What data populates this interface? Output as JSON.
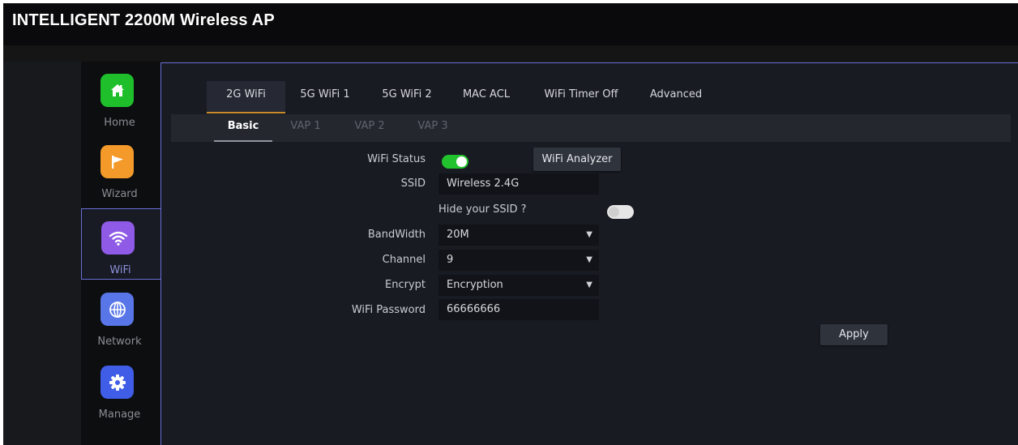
{
  "app": {
    "title": "INTELLIGENT 2200M Wireless AP"
  },
  "sidebar": {
    "items": [
      {
        "label": "Home",
        "icon": "home-icon",
        "color": "#1fbf2c"
      },
      {
        "label": "Wizard",
        "icon": "flag-icon",
        "color": "#f39a2a"
      },
      {
        "label": "WiFi",
        "icon": "wifi-icon",
        "color": "#8e5ae6"
      },
      {
        "label": "Network",
        "icon": "globe-icon",
        "color": "#5876e8"
      },
      {
        "label": "Manage",
        "icon": "gear-icon",
        "color": "#3f5de6"
      }
    ],
    "active": "WiFi"
  },
  "tabs": [
    "2G WiFi",
    "5G WiFi 1",
    "5G WiFi 2",
    "MAC ACL",
    "WiFi Timer Off",
    "Advanced"
  ],
  "active_tab": "2G WiFi",
  "subtabs": [
    "Basic",
    "VAP 1",
    "VAP 2",
    "VAP 3"
  ],
  "active_subtab": "Basic",
  "form": {
    "wifi_status_label": "WiFi Status",
    "wifi_status_on": true,
    "analyzer_button": "WiFi Analyzer",
    "ssid_label": "SSID",
    "ssid_value": "Wireless 2.4G",
    "hide_ssid_label": "Hide your SSID ?",
    "hide_ssid_on": false,
    "bandwidth_label": "BandWidth",
    "bandwidth_value": "20M",
    "channel_label": "Channel",
    "channel_value": "9",
    "encrypt_label": "Encrypt",
    "encrypt_value": "Encryption",
    "password_label": "WiFi Password",
    "password_value": "66666666",
    "apply_button": "Apply"
  },
  "colors": {
    "accent_border": "#6a6ed6",
    "active_tab_underline": "#c98a2a",
    "toggle_on": "#22c22e",
    "toggle_off": "#e6e6e6"
  }
}
